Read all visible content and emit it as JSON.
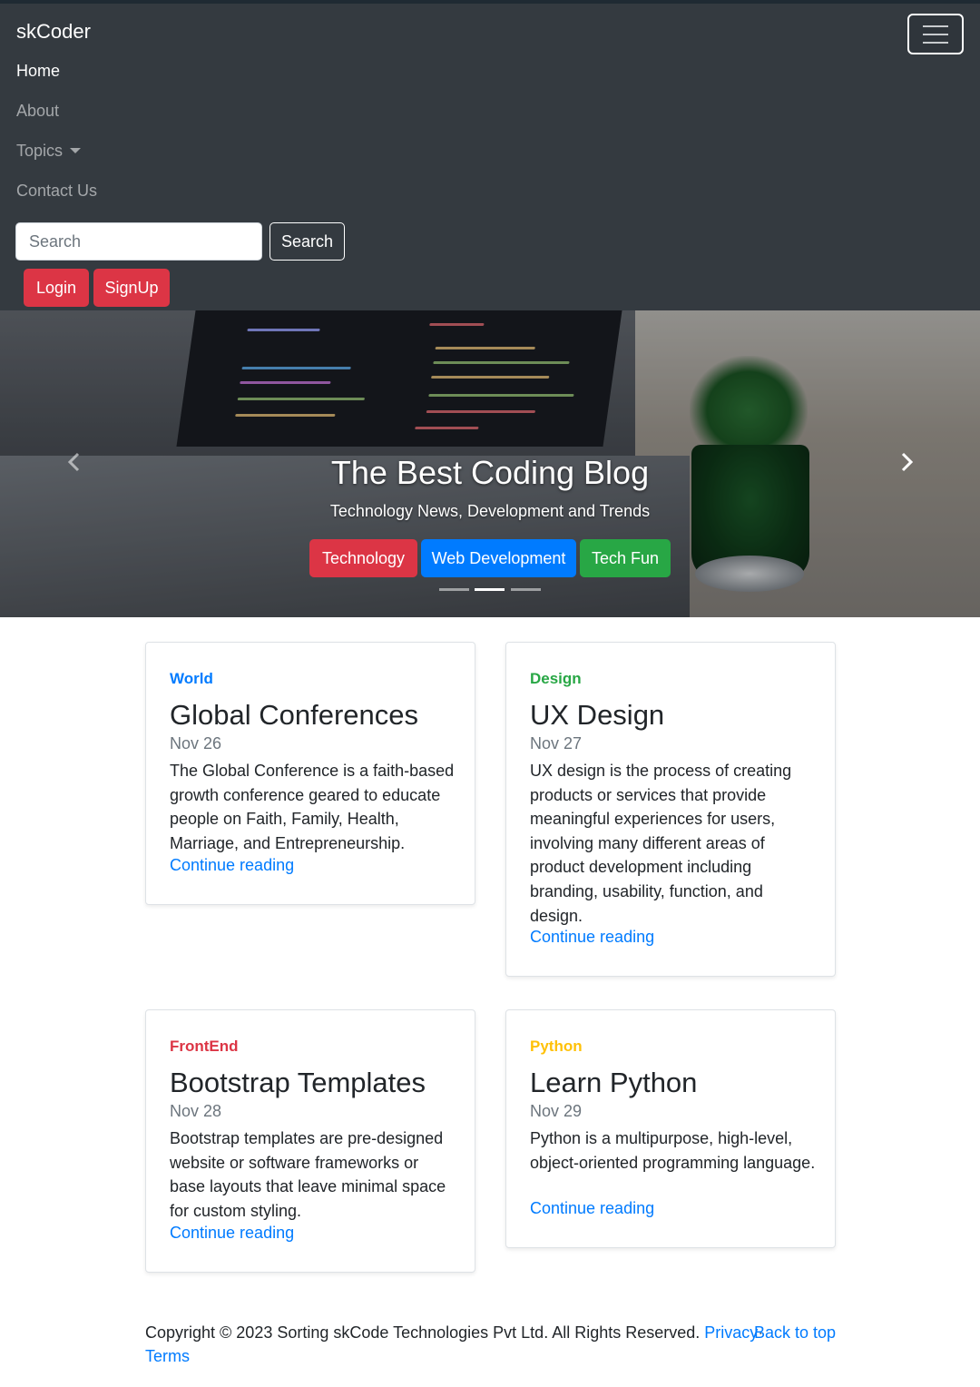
{
  "navbar": {
    "brand": "skCoder",
    "links": {
      "home": "Home",
      "about": "About",
      "topics": "Topics",
      "contact": "Contact Us"
    },
    "search": {
      "placeholder": "Search",
      "button": "Search"
    },
    "auth": {
      "login": "Login",
      "signup": "SignUp"
    },
    "toggler_icon": "hamburger-icon"
  },
  "hero": {
    "title": "The Best Coding Blog",
    "subtitle": "Technology News, Development and Trends",
    "buttons": {
      "technology": "Technology",
      "web": "Web Development",
      "fun": "Tech Fun"
    },
    "slide_count": 3,
    "active_slide": 2
  },
  "cards": [
    {
      "category": "World",
      "category_color": "#007bff",
      "title": "Global Conferences",
      "date": "Nov 26",
      "text": "The Global Conference is a faith-based growth conference geared to educate people on Faith, Family, Health, Marriage, and Entrepreneurship.",
      "link": "Continue reading"
    },
    {
      "category": "Design",
      "category_color": "#28a745",
      "title": "UX Design",
      "date": "Nov 27",
      "text": "UX design is the process of creating products or services that provide meaningful experiences for users, involving many different areas of product development including branding, usability, function, and design.",
      "link": "Continue reading"
    },
    {
      "category": "FrontEnd",
      "category_color": "#dc3545",
      "title": "Bootstrap Templates",
      "date": "Nov 28",
      "text": "Bootstrap templates are pre-designed website or software frameworks or base layouts that leave minimal space for custom styling.",
      "link": "Continue reading"
    },
    {
      "category": "Python",
      "category_color": "#ffc107",
      "title": "Learn Python",
      "date": "Nov 29",
      "text": "Python is a multipurpose, high-level, object-oriented programming language.",
      "link": "Continue reading"
    }
  ],
  "footer": {
    "copyright": "Copyright © 2023 Sorting skCode Technologies Pvt Ltd. All Rights Reserved.",
    "privacy": "Privacy",
    "separator": "·",
    "terms": "Terms",
    "back_to_top": "Back to top"
  }
}
